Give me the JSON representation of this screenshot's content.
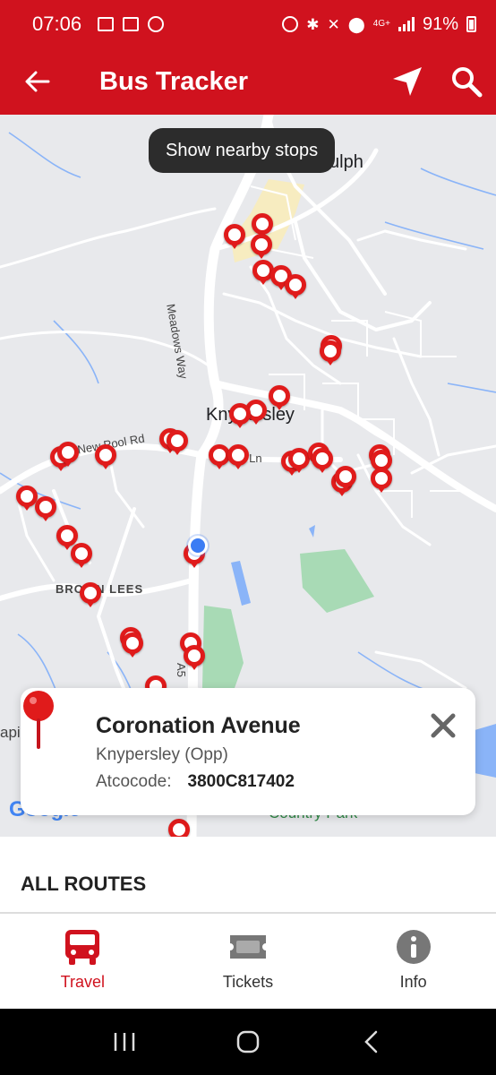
{
  "status_bar": {
    "time": "07:06",
    "network": "4G+",
    "battery": "91%"
  },
  "app_bar": {
    "title": "Bus Tracker",
    "icons": [
      "back-arrow-icon",
      "navigation-arrow-icon",
      "search-icon"
    ]
  },
  "map": {
    "toast": "Show nearby stops",
    "labels": {
      "town_biddulph": "Biddulph",
      "town_knypersley": "Knypersley",
      "road_meadows": "Meadows Way",
      "road_newpool": "New Pool Rd",
      "road_ln": "k Ln",
      "road_a5": "A5",
      "area_brown_lees": "BROWN LEES",
      "area_left": "api",
      "google_logo": "Google",
      "park": "Country Park"
    },
    "colors": {
      "stop": "#e01b1b",
      "road": "#ffffff",
      "park": "#a8dab5",
      "water": "#8ab4f8"
    }
  },
  "stop_card": {
    "name": "Coronation Avenue",
    "locality": "Knypersley (Opp)",
    "code_label": "Atcocode:",
    "code_value": "3800C817402"
  },
  "routes": {
    "title": "ALL ROUTES"
  },
  "bottom_nav": {
    "items": [
      {
        "label": "Travel",
        "icon": "bus-icon",
        "active": true
      },
      {
        "label": "Tickets",
        "icon": "ticket-icon",
        "active": false
      },
      {
        "label": "Info",
        "icon": "info-icon",
        "active": false
      }
    ]
  },
  "theme": {
    "primary": "#d0121e"
  }
}
